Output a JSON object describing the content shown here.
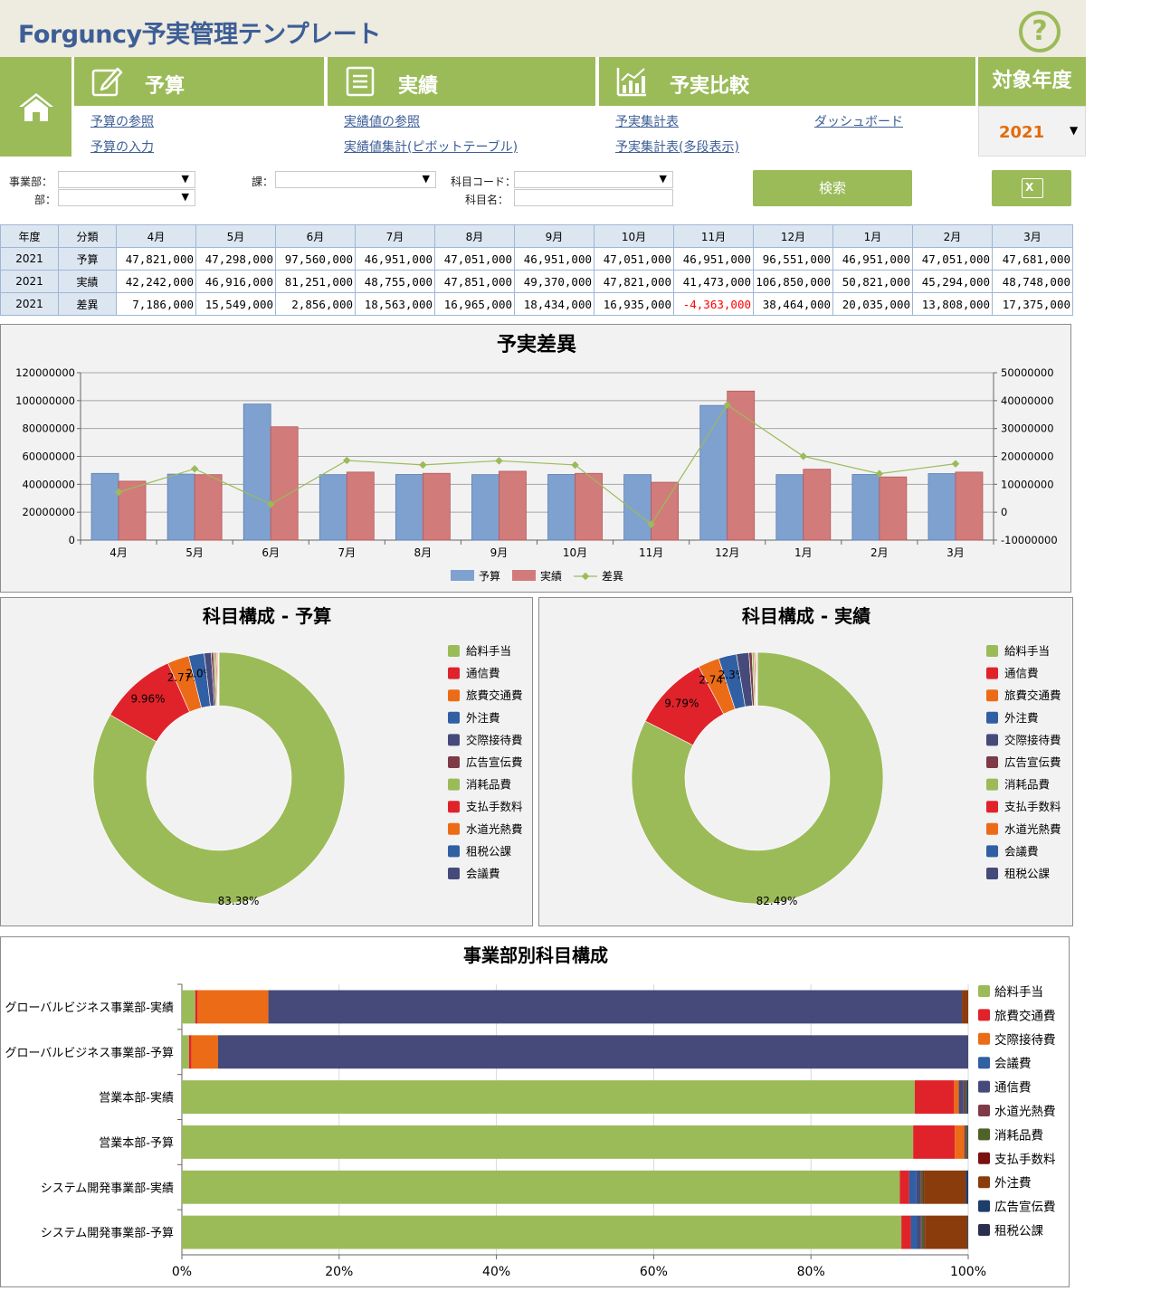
{
  "app": {
    "title": "Forguncy予実管理テンプレート",
    "help_glyph": "?"
  },
  "nav": {
    "budget": {
      "label": "予算",
      "links": [
        "予算の参照",
        "予算の入力"
      ]
    },
    "actual": {
      "label": "実績",
      "links": [
        "実績値の参照",
        "実績値集計(ピボットテーブル)"
      ]
    },
    "compare": {
      "label": "予実比較",
      "links": [
        "予実集計表",
        "ダッシュボード",
        "予実集計表(多段表示)"
      ]
    },
    "year": {
      "label": "対象年度",
      "value": "2021"
    }
  },
  "filters": {
    "division_label": "事業部：",
    "dept_label": "部：",
    "section_label": "課：",
    "code_label": "科目コード：",
    "name_label": "科目名：",
    "search_label": "検索",
    "excel_glyph": "X"
  },
  "table": {
    "headers": [
      "年度",
      "分類",
      "4月",
      "5月",
      "6月",
      "7月",
      "8月",
      "9月",
      "10月",
      "11月",
      "12月",
      "1月",
      "2月",
      "3月"
    ],
    "rows": [
      [
        "2021",
        "予算",
        "47,821,000",
        "47,298,000",
        "97,560,000",
        "46,951,000",
        "47,051,000",
        "46,951,000",
        "47,051,000",
        "46,951,000",
        "96,551,000",
        "46,951,000",
        "47,051,000",
        "47,681,000"
      ],
      [
        "2021",
        "実績",
        "42,242,000",
        "46,916,000",
        "81,251,000",
        "48,755,000",
        "47,851,000",
        "49,370,000",
        "47,821,000",
        "41,473,000",
        "106,850,000",
        "50,821,000",
        "45,294,000",
        "48,748,000"
      ],
      [
        "2021",
        "差異",
        "7,186,000",
        "15,549,000",
        "2,856,000",
        "18,563,000",
        "16,965,000",
        "18,434,000",
        "16,935,000",
        "-4,363,000",
        "38,464,000",
        "20,035,000",
        "13,808,000",
        "17,375,000"
      ]
    ]
  },
  "chart_data": [
    {
      "type": "bar",
      "title": "予実差異",
      "categories": [
        "4月",
        "5月",
        "6月",
        "7月",
        "8月",
        "9月",
        "10月",
        "11月",
        "12月",
        "1月",
        "2月",
        "3月"
      ],
      "series": [
        {
          "name": "予算",
          "kind": "bar",
          "axis": "left",
          "color": "#7fa1cf",
          "values": [
            47821000,
            47298000,
            97560000,
            46951000,
            47051000,
            46951000,
            47051000,
            46951000,
            96551000,
            46951000,
            47051000,
            47681000
          ]
        },
        {
          "name": "実績",
          "kind": "bar",
          "axis": "left",
          "color": "#d27b7b",
          "values": [
            42242000,
            46916000,
            81251000,
            48755000,
            47851000,
            49370000,
            47821000,
            41473000,
            106850000,
            50821000,
            45294000,
            48748000
          ]
        },
        {
          "name": "差異",
          "kind": "line",
          "axis": "right",
          "color": "#9bbb59",
          "values": [
            7186000,
            15549000,
            2856000,
            18563000,
            16965000,
            18434000,
            16935000,
            -4363000,
            38464000,
            20035000,
            13808000,
            17375000
          ]
        }
      ],
      "ylim_left": [
        0,
        120000000
      ],
      "ylim_right": [
        -10000000,
        50000000
      ],
      "yticks_left": [
        "0",
        "20000000",
        "40000000",
        "60000000",
        "80000000",
        "100000000",
        "120000000"
      ],
      "yticks_right": [
        "-10000000",
        "0",
        "10000000",
        "20000000",
        "30000000",
        "40000000",
        "50000000"
      ],
      "grid": true,
      "legend": "bottom"
    },
    {
      "type": "pie",
      "title": "科目構成 - 予算",
      "slices": [
        {
          "name": "給料手当",
          "value": 83.38,
          "label": "83.38%",
          "color": "#9bbb59"
        },
        {
          "name": "通信費",
          "value": 9.96,
          "label": "9.96%",
          "color": "#e0232a"
        },
        {
          "name": "旅費交通費",
          "value": 2.77,
          "label": "2.77%",
          "color": "#ec6b16"
        },
        {
          "name": "外注費",
          "value": 2.0,
          "label": "2.0%",
          "color": "#305fa4"
        },
        {
          "name": "交際接待費",
          "value": 0.9,
          "label": "",
          "color": "#464a7b"
        },
        {
          "name": "広告宣伝費",
          "value": 0.3,
          "label": "",
          "color": "#7e3a47"
        },
        {
          "name": "消耗品費",
          "value": 0.25,
          "label": "",
          "color": "#9bbb59"
        },
        {
          "name": "支払手数料",
          "value": 0.15,
          "label": "",
          "color": "#e0232a"
        },
        {
          "name": "水道光熱費",
          "value": 0.12,
          "label": "",
          "color": "#ec6b16"
        },
        {
          "name": "租税公課",
          "value": 0.1,
          "label": "",
          "color": "#305fa4"
        },
        {
          "name": "会議費",
          "value": 0.07,
          "label": "",
          "color": "#464a7b"
        }
      ],
      "legend": "right"
    },
    {
      "type": "pie",
      "title": "科目構成 - 実績",
      "slices": [
        {
          "name": "給料手当",
          "value": 82.49,
          "label": "82.49%",
          "color": "#9bbb59"
        },
        {
          "name": "通信費",
          "value": 9.79,
          "label": "9.79%",
          "color": "#e0232a"
        },
        {
          "name": "旅費交通費",
          "value": 2.74,
          "label": "2.74%",
          "color": "#ec6b16"
        },
        {
          "name": "外注費",
          "value": 2.3,
          "label": "2.3%",
          "color": "#305fa4"
        },
        {
          "name": "交際接待費",
          "value": 1.6,
          "label": "",
          "color": "#464a7b"
        },
        {
          "name": "広告宣伝費",
          "value": 0.4,
          "label": "",
          "color": "#7e3a47"
        },
        {
          "name": "消耗品費",
          "value": 0.25,
          "label": "",
          "color": "#9bbb59"
        },
        {
          "name": "支払手数料",
          "value": 0.15,
          "label": "",
          "color": "#e0232a"
        },
        {
          "name": "水道光熱費",
          "value": 0.12,
          "label": "",
          "color": "#ec6b16"
        },
        {
          "name": "会議費",
          "value": 0.1,
          "label": "",
          "color": "#305fa4"
        },
        {
          "name": "租税公課",
          "value": 0.06,
          "label": "",
          "color": "#464a7b"
        }
      ],
      "legend": "right"
    },
    {
      "type": "bar",
      "stacked": "percent",
      "orientation": "horizontal",
      "title": "事業部別科目構成",
      "categories": [
        "グローバルビジネス事業部-実績",
        "グローバルビジネス事業部-予算",
        "営業本部-実績",
        "営業本部-予算",
        "システム開発事業部-実績",
        "システム開発事業部-予算"
      ],
      "xticks": [
        "0%",
        "20%",
        "40%",
        "60%",
        "80%",
        "100%"
      ],
      "series": [
        {
          "name": "給料手当",
          "color": "#9bbb59",
          "values": [
            1.7,
            0.9,
            93.2,
            93.0,
            91.3,
            91.5
          ]
        },
        {
          "name": "旅費交通費",
          "color": "#e0232a",
          "values": [
            0.3,
            0.3,
            5.0,
            5.3,
            1.2,
            1.2
          ]
        },
        {
          "name": "交際接待費",
          "color": "#ec6b16",
          "values": [
            9.0,
            3.4,
            0.6,
            1.2,
            0.0,
            0.0
          ]
        },
        {
          "name": "会議費",
          "color": "#305fa4",
          "values": [
            0.0,
            0.0,
            0.0,
            0.0,
            0.9,
            0.8
          ]
        },
        {
          "name": "通信費",
          "color": "#464a7b",
          "values": [
            88.2,
            95.4,
            0.6,
            0.0,
            0.5,
            0.5
          ]
        },
        {
          "name": "水道光熱費",
          "color": "#7e3a47",
          "values": [
            0.0,
            0.0,
            0.2,
            0.2,
            0.1,
            0.1
          ]
        },
        {
          "name": "消耗品費",
          "color": "#4f6228",
          "values": [
            0.0,
            0.0,
            0.2,
            0.2,
            0.3,
            0.3
          ]
        },
        {
          "name": "支払手数料",
          "color": "#7a1010",
          "values": [
            0.0,
            0.0,
            0.0,
            0.0,
            0.1,
            0.1
          ]
        },
        {
          "name": "外注費",
          "color": "#8a3c0c",
          "values": [
            0.8,
            0.0,
            0.0,
            0.0,
            5.3,
            5.4
          ]
        },
        {
          "name": "広告宣伝費",
          "color": "#1f3d6b",
          "values": [
            0.0,
            0.0,
            0.2,
            0.1,
            0.3,
            0.1
          ]
        },
        {
          "name": "租税公課",
          "color": "#2a2f4f",
          "values": [
            0.0,
            0.0,
            0.0,
            0.0,
            0.0,
            0.0
          ]
        }
      ],
      "legend": "right"
    }
  ]
}
